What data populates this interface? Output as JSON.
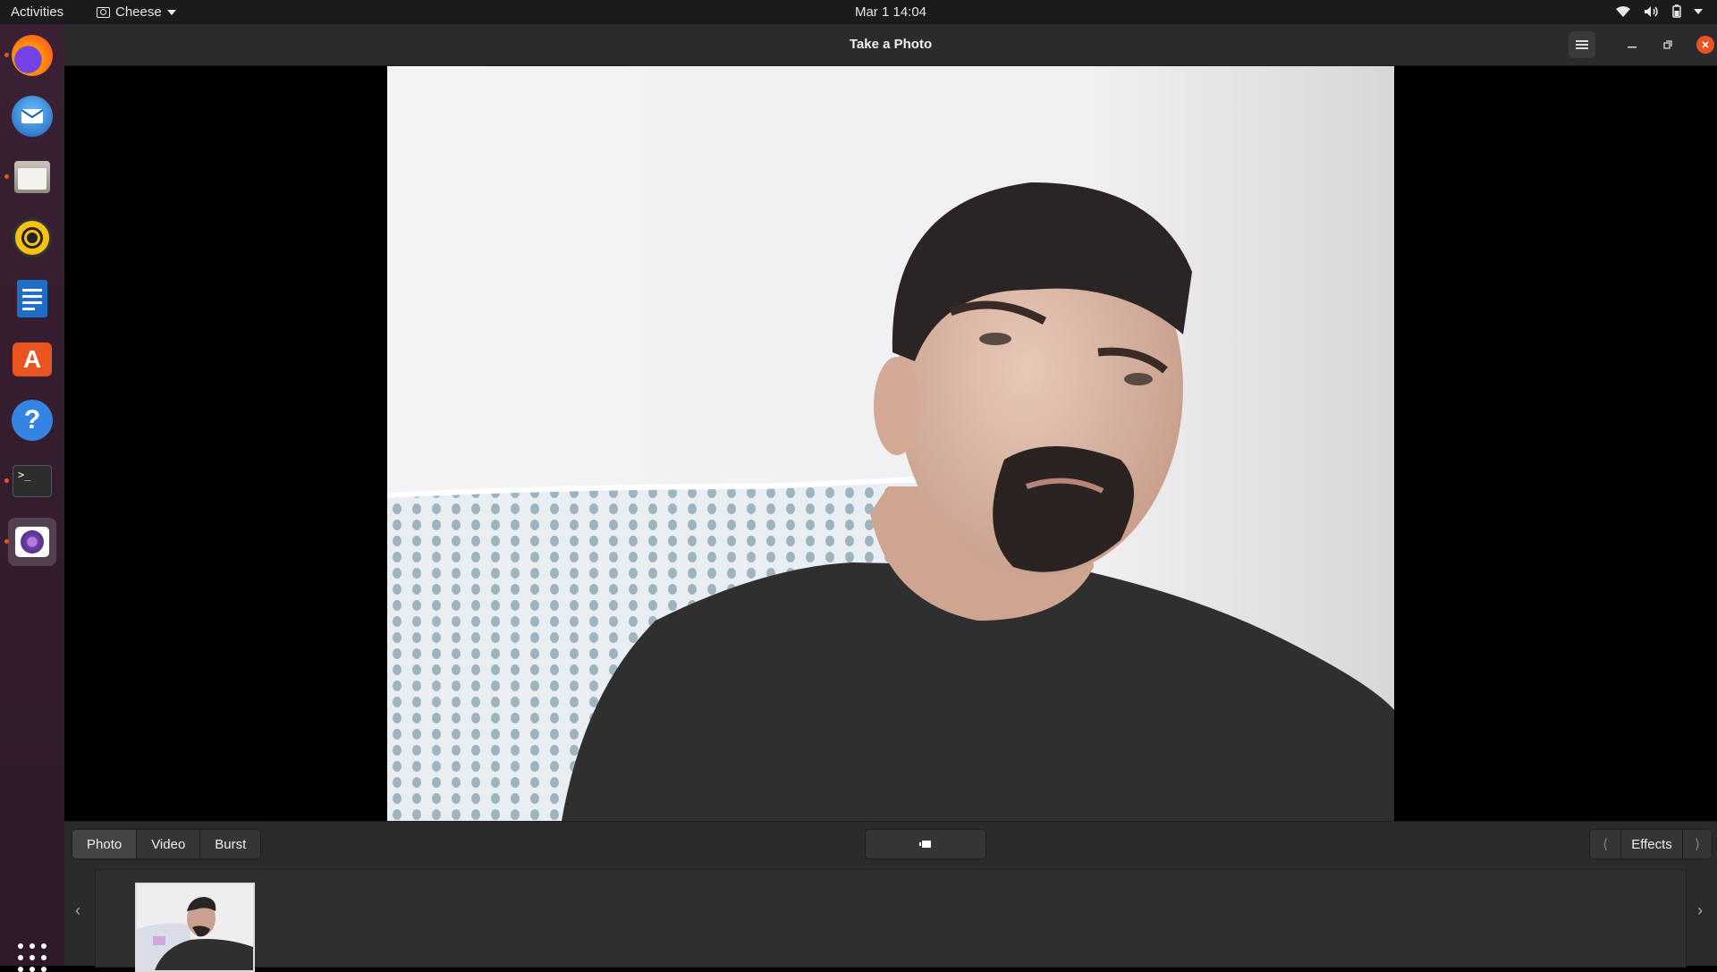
{
  "topbar": {
    "activities": "Activities",
    "app_name": "Cheese",
    "clock": "Mar 1  14:04",
    "status_icons": [
      "wifi-icon",
      "volume-icon",
      "battery-icon",
      "system-menu-icon"
    ]
  },
  "dock": {
    "items": [
      {
        "name": "firefox",
        "icon": "firefox-icon",
        "running": true
      },
      {
        "name": "thunderbird",
        "icon": "thunderbird-icon",
        "running": false
      },
      {
        "name": "files",
        "icon": "files-icon",
        "running": true
      },
      {
        "name": "rhythmbox",
        "icon": "rhythmbox-icon",
        "running": false
      },
      {
        "name": "libreoffice-writer",
        "icon": "writer-icon",
        "running": false
      },
      {
        "name": "ubuntu-software",
        "icon": "software-icon",
        "running": false
      },
      {
        "name": "help",
        "icon": "help-icon",
        "running": false
      },
      {
        "name": "terminal",
        "icon": "terminal-icon",
        "running": true
      },
      {
        "name": "cheese",
        "icon": "cheese-icon",
        "running": true,
        "active": true
      }
    ],
    "show_apps_icon": "app-grid-icon"
  },
  "window": {
    "title": "Take a Photo",
    "buttons": [
      "menu-icon",
      "minimize-icon",
      "maximize-icon",
      "close-icon"
    ]
  },
  "modes": {
    "photo": "Photo",
    "video": "Video",
    "burst": "Burst",
    "selected": "Photo"
  },
  "effects": {
    "label": "Effects",
    "prev": "⟨",
    "next": "⟩"
  },
  "thumbnails": {
    "count_shown": 1,
    "prev": "‹",
    "next": "›"
  },
  "colors": {
    "accent": "#e95420",
    "topbar_bg": "#1b1b1b",
    "window_bg": "#2b2b2b",
    "dock_bg": "#3a2033"
  }
}
